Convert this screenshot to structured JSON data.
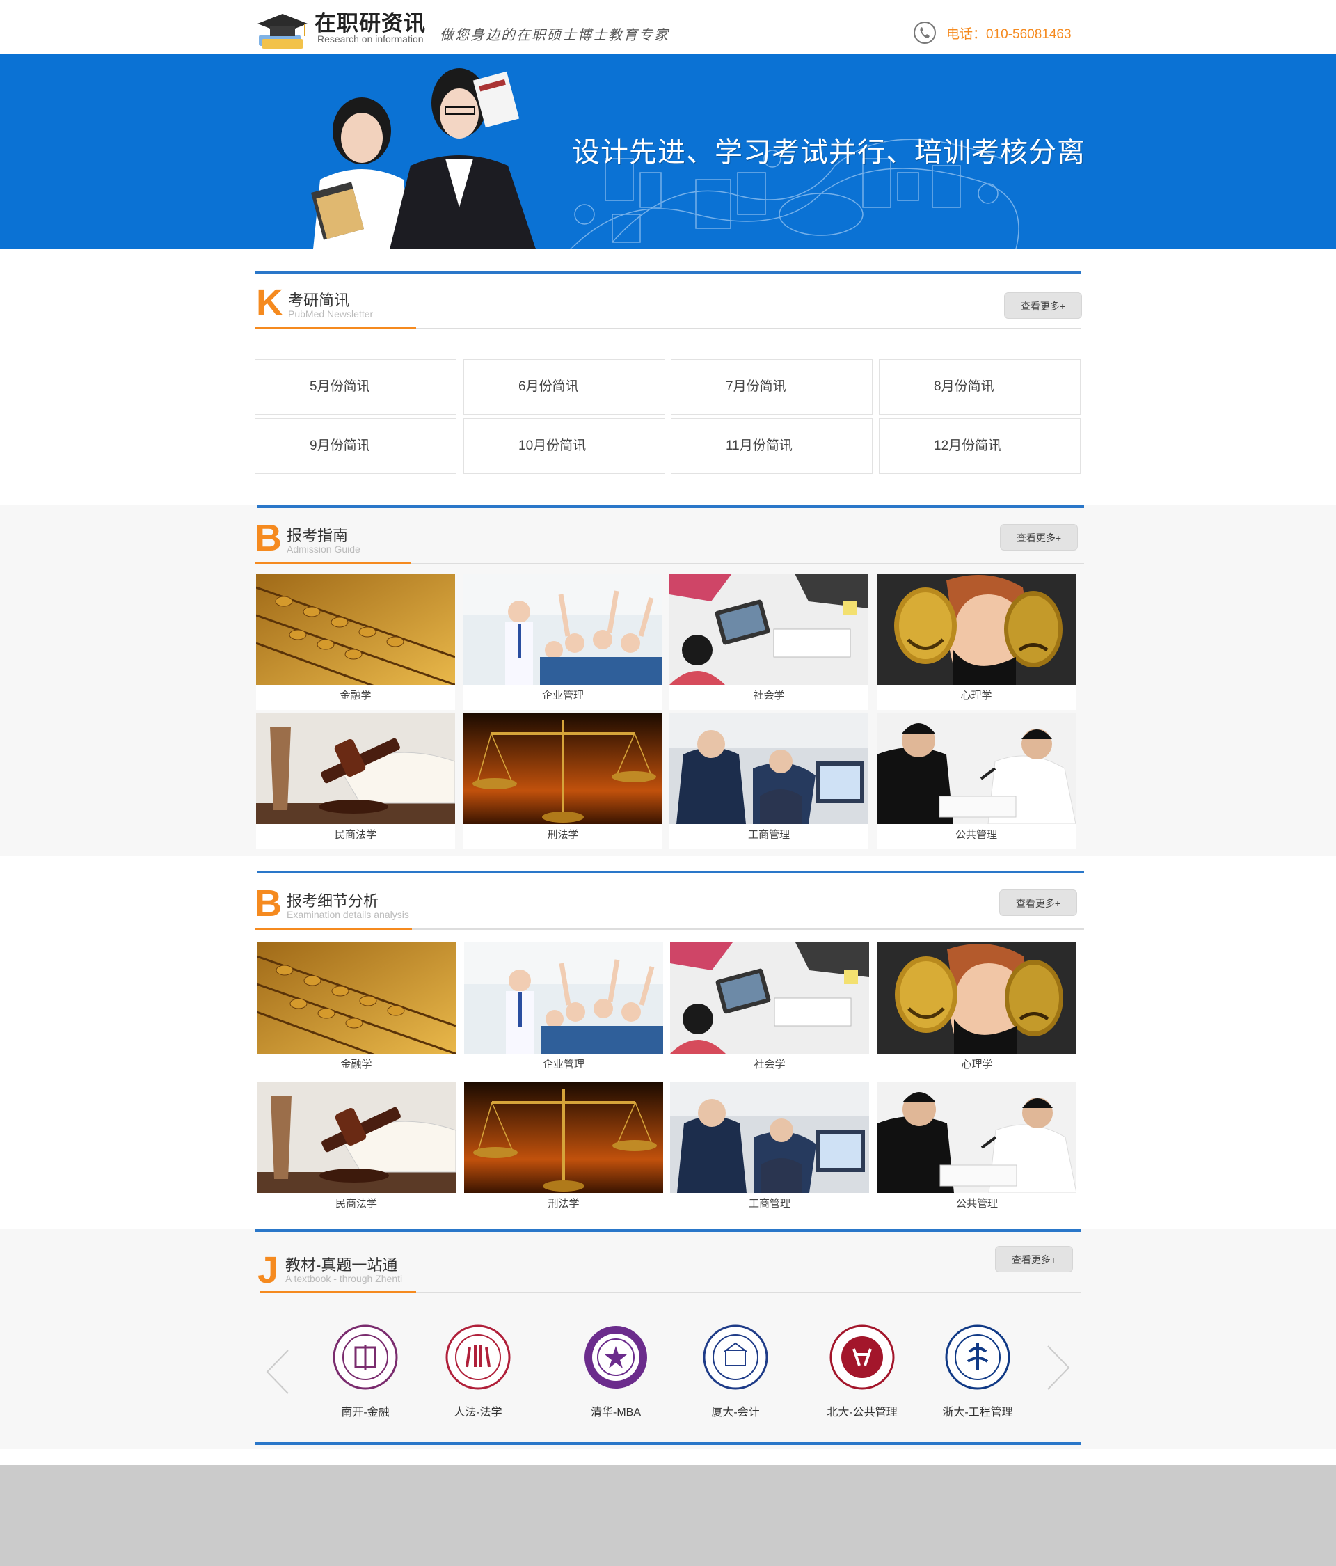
{
  "header": {
    "logo_title": "在职研资讯",
    "logo_subtitle": "Research on information",
    "slogan": "做您身边的在职硕士博士教育专家",
    "phone": "电话：010-56081463"
  },
  "banner": {
    "headline": "设计先进、学习考试并行、培训考核分离"
  },
  "newsletter": {
    "letter": "K",
    "title": "考研简讯",
    "subtitle": "PubMed Newsletter",
    "more": "查看更多+",
    "items": [
      "5月份简讯",
      "6月份简讯",
      "7月份简讯",
      "8月份简讯",
      "9月份简讯",
      "10月份简讯",
      "11月份简讯",
      "12月份简讯"
    ]
  },
  "guide": {
    "letter": "B",
    "title": "报考指南",
    "subtitle": "Admission Guide",
    "more": "查看更多+",
    "items": [
      "金融学",
      "企业管理",
      "社会学",
      "心理学",
      "民商法学",
      "刑法学",
      "工商管理",
      "公共管理"
    ]
  },
  "details": {
    "letter": "B",
    "title": "报考细节分析",
    "subtitle": "Examination details analysis",
    "more": "查看更多+",
    "items": [
      "金融学",
      "企业管理",
      "社会学",
      "心理学",
      "民商法学",
      "刑法学",
      "工商管理",
      "公共管理"
    ]
  },
  "textbook": {
    "letter": "J",
    "title": "教材-真题一站通",
    "subtitle": "A textbook - through Zhenti",
    "more": "查看更多+",
    "items": [
      "南开-金融",
      "人法-法学",
      "清华-MBA",
      "厦大-会计",
      "北大-公共管理",
      "浙大-工程管理"
    ]
  },
  "colors": {
    "accent_orange": "#f58a1f",
    "accent_blue": "#2a77c9",
    "banner_blue": "#0b72d4"
  }
}
